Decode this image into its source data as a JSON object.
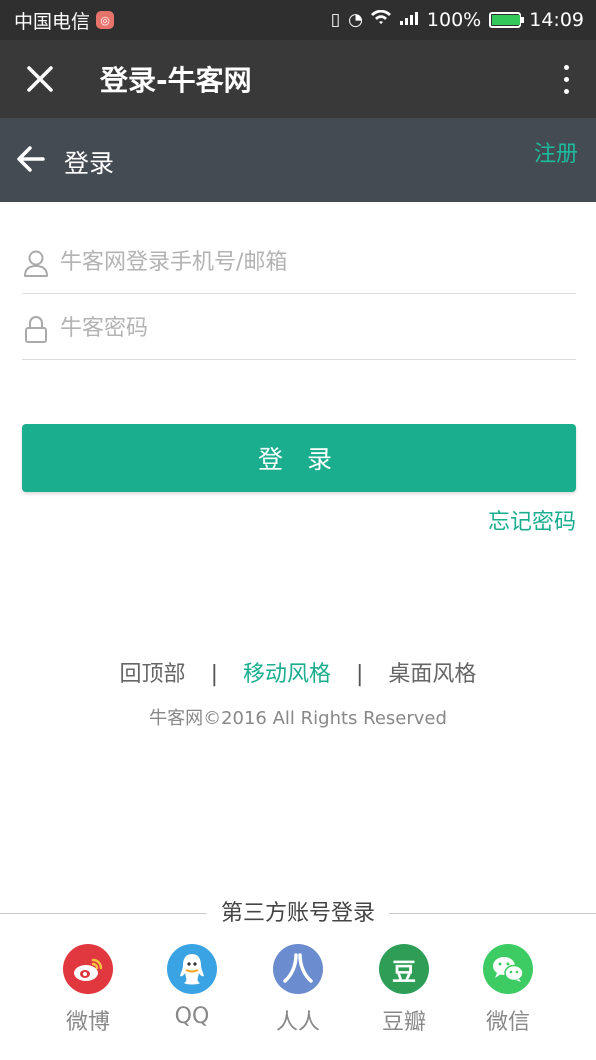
{
  "status_bar": {
    "carrier": "中国电信",
    "battery": "100%",
    "battery_level": 1.0,
    "time": "14:09"
  },
  "title_bar": {
    "title": "登录-牛客网"
  },
  "header": {
    "title": "登录",
    "register": "注册"
  },
  "form": {
    "account_placeholder": "牛客网登录手机号/邮箱",
    "password_placeholder": "牛客密码",
    "login_label": "登 录",
    "forgot_label": "忘记密码"
  },
  "footer": {
    "back_to_top": "回顶部",
    "sep": "|",
    "mobile_style": "移动风格",
    "desktop_style": "桌面风格",
    "copyright": "牛客网©2016 All Rights Reserved"
  },
  "third_party": {
    "title": "第三方账号登录",
    "items": [
      {
        "label": "微博",
        "icon": "weibo-icon",
        "color": "#e0383e"
      },
      {
        "label": "QQ",
        "icon": "qq-icon",
        "color": "#3aa3e3"
      },
      {
        "label": "人人",
        "icon": "renren-icon",
        "color": "#6b8cce"
      },
      {
        "label": "豆瓣",
        "icon": "douban-icon",
        "color": "#2e9e57",
        "glyph": "豆"
      },
      {
        "label": "微信",
        "icon": "wechat-icon",
        "color": "#3dcc64"
      }
    ]
  },
  "colors": {
    "accent": "#1aae8e",
    "title_bar": "#393939",
    "header": "#454b52"
  }
}
